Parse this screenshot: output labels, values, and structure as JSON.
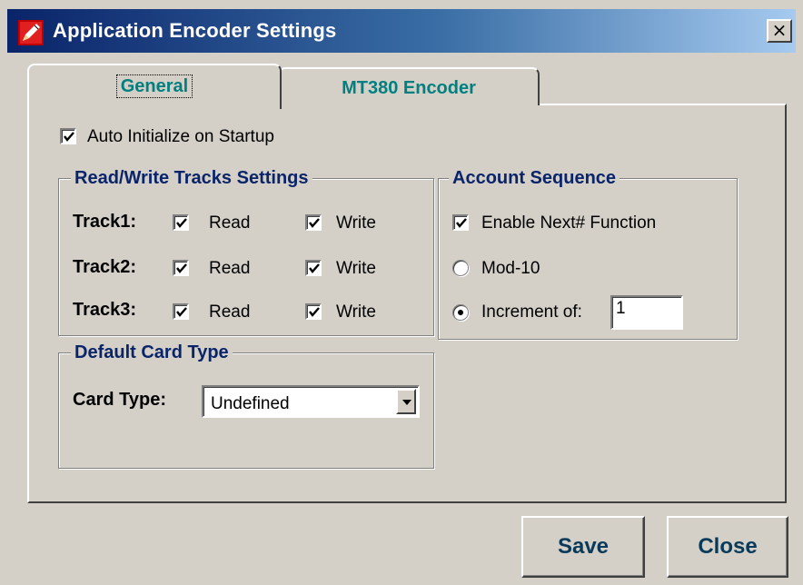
{
  "window": {
    "title": "Application Encoder Settings",
    "close_glyph": "×",
    "icon": "pencil-app-icon"
  },
  "tabs": [
    {
      "label": "General",
      "active": true
    },
    {
      "label": "MT380 Encoder",
      "active": false
    }
  ],
  "general": {
    "auto_init_label": "Auto Initialize on Startup",
    "auto_init_checked": true
  },
  "rw_tracks": {
    "title": "Read/Write Tracks Settings",
    "read_label": "Read",
    "write_label": "Write",
    "tracks": [
      {
        "label": "Track1:",
        "read": true,
        "write": true
      },
      {
        "label": "Track2:",
        "read": true,
        "write": true
      },
      {
        "label": "Track3:",
        "read": true,
        "write": true
      }
    ]
  },
  "account_sequence": {
    "title": "Account Sequence",
    "enable_next_label": "Enable Next# Function",
    "enable_next_checked": true,
    "mod10_label": "Mod-10",
    "mod10_selected": false,
    "increment_label": "Increment of:",
    "increment_selected": true,
    "increment_value": "1"
  },
  "default_card_type": {
    "title": "Default Card Type",
    "card_type_label": "Card Type:",
    "selected_value": "Undefined"
  },
  "buttons": {
    "save_label": "Save",
    "close_label": "Close"
  },
  "colors": {
    "title_bar_start": "#0a246a",
    "title_bar_end": "#a6caf0",
    "tab_text": "#008080",
    "group_title": "#0a246a",
    "face": "#d4d0c8"
  }
}
